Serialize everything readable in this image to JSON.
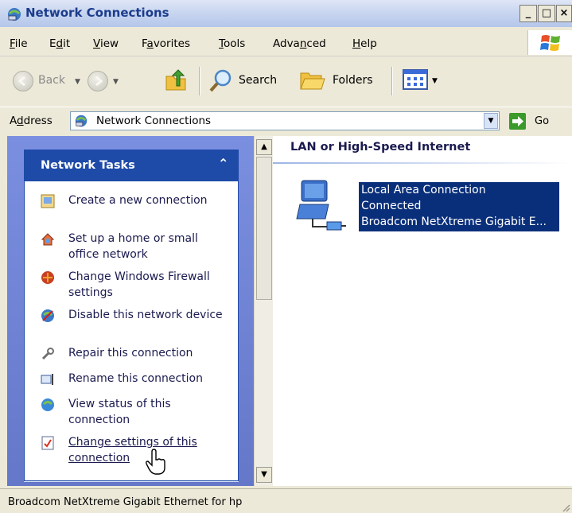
{
  "window": {
    "title": "Network Connections"
  },
  "menu": {
    "items": [
      {
        "pre": "",
        "key": "F",
        "post": "ile"
      },
      {
        "pre": "E",
        "key": "d",
        "post": "it"
      },
      {
        "pre": "",
        "key": "V",
        "post": "iew"
      },
      {
        "pre": "F",
        "key": "a",
        "post": "vorites"
      },
      {
        "pre": "",
        "key": "T",
        "post": "ools"
      },
      {
        "pre": "Adva",
        "key": "n",
        "post": "ced"
      },
      {
        "pre": "",
        "key": "H",
        "post": "elp"
      }
    ]
  },
  "toolbar": {
    "back": "Back",
    "search": "Search",
    "folders": "Folders"
  },
  "address": {
    "label_pre": "A",
    "label_key": "d",
    "label_post": "dress",
    "value": "Network Connections",
    "go": "Go"
  },
  "tasks": {
    "title": "Network Tasks",
    "collapse_glyph": "⌃",
    "items": [
      {
        "label": "Create a new connection",
        "icon": "new-connection-icon"
      },
      {
        "label": "Set up a home or small office network",
        "icon": "home-network-icon"
      },
      {
        "label": "Change Windows Firewall settings",
        "icon": "firewall-icon"
      },
      {
        "label": "Disable this network device",
        "icon": "disable-device-icon"
      },
      {
        "label": "Repair this connection",
        "icon": "repair-icon"
      },
      {
        "label": "Rename this connection",
        "icon": "rename-icon"
      },
      {
        "label": "View status of this connection",
        "icon": "status-icon"
      },
      {
        "label": "Change settings of this connection",
        "icon": "settings-icon"
      }
    ]
  },
  "content": {
    "group_title": "LAN or High-Speed Internet",
    "connection": {
      "name": "Local Area Connection",
      "status": "Connected",
      "device": "Broadcom NetXtreme Gigabit E..."
    }
  },
  "statusbar": {
    "text": "Broadcom NetXtreme Gigabit Ethernet for hp"
  }
}
